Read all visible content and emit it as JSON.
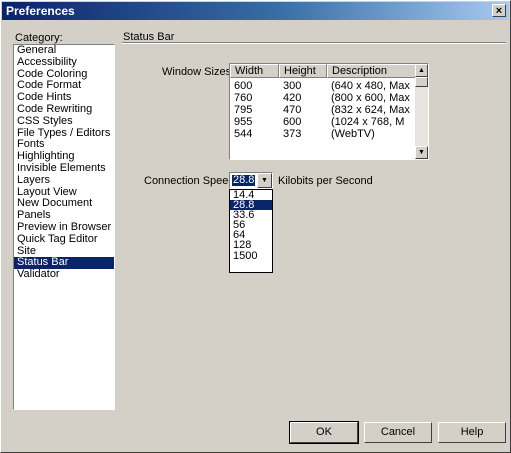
{
  "window": {
    "title": "Preferences",
    "close_glyph": "×"
  },
  "category": {
    "label": "Category:",
    "items": [
      "General",
      "Accessibility",
      "Code Coloring",
      "Code Format",
      "Code Hints",
      "Code Rewriting",
      "CSS Styles",
      "File Types / Editors",
      "Fonts",
      "Highlighting",
      "Invisible Elements",
      "Layers",
      "Layout View",
      "New Document",
      "Panels",
      "Preview in Browser",
      "Quick Tag Editor",
      "Site",
      "Status Bar",
      "Validator"
    ],
    "selected": "Status Bar"
  },
  "panel": {
    "title": "Status Bar"
  },
  "window_sizes": {
    "label": "Window Sizes:",
    "columns": [
      "Width",
      "Height",
      "Description"
    ],
    "rows": [
      [
        "600",
        "300",
        "(640 x 480, Max"
      ],
      [
        "760",
        "420",
        "(800 x 600, Max"
      ],
      [
        "795",
        "470",
        "(832 x 624, Max"
      ],
      [
        "955",
        "600",
        "(1024 x 768, M"
      ],
      [
        "544",
        "373",
        "(WebTV)"
      ]
    ]
  },
  "connection_speed": {
    "label": "Connection Speed:",
    "value": "28.8",
    "unit": "Kilobits per Second",
    "options": [
      "14.4",
      "28.8",
      "33.6",
      "56",
      "64",
      "128",
      "1500"
    ]
  },
  "buttons": {
    "ok": "OK",
    "cancel": "Cancel",
    "help": "Help"
  },
  "colors": {
    "selection": "#0a246a",
    "face": "#d4d0c8"
  }
}
